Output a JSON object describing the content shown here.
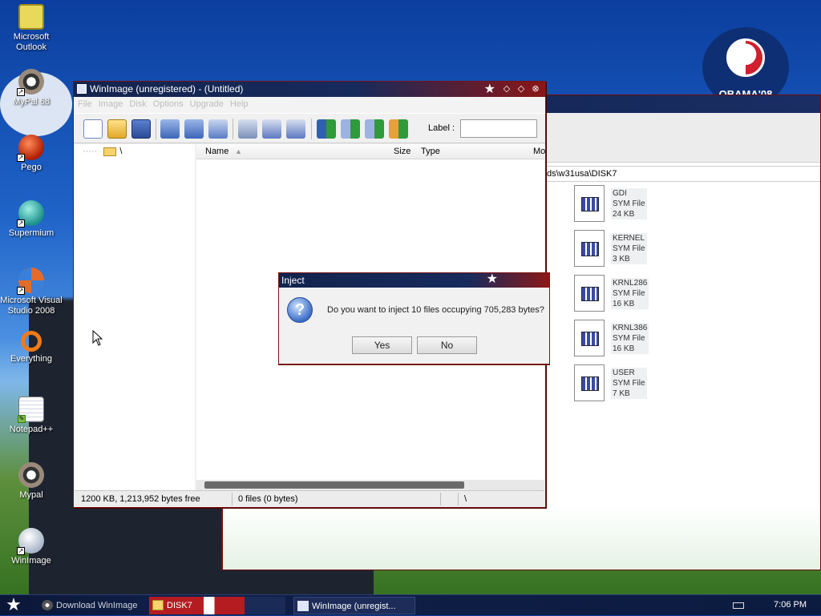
{
  "desktop": {
    "icons": [
      {
        "label": "Microsoft Outlook"
      },
      {
        "label": "MyPal 68"
      },
      {
        "label": "Pego"
      },
      {
        "label": "Supermium"
      },
      {
        "label": "Microsoft Visual Studio 2008"
      },
      {
        "label": "Everything"
      },
      {
        "label": "Notepad++"
      },
      {
        "label": "Mypal"
      },
      {
        "label": "WinImage"
      }
    ],
    "logo_text": "OBAMA'08"
  },
  "explorer": {
    "address": "ds\\w31usa\\DISK7",
    "files": [
      {
        "name": "GDI",
        "type": "SYM File",
        "size": "24 KB"
      },
      {
        "name": "KERNEL",
        "type": "SYM File",
        "size": "3 KB"
      },
      {
        "name": "KRNL286",
        "type": "SYM File",
        "size": "16 KB"
      },
      {
        "name": "KRNL386",
        "type": "SYM File",
        "size": "16 KB"
      },
      {
        "name": "USER",
        "type": "SYM File",
        "size": "7 KB"
      }
    ]
  },
  "winimage": {
    "title": "WinImage (unregistered) - (Untitled)",
    "menu": [
      "File",
      "Image",
      "Disk",
      "Options",
      "Upgrade",
      "Help"
    ],
    "label_caption": "Label :",
    "tree_root": "\\",
    "columns": {
      "name": "Name",
      "size": "Size",
      "type": "Type",
      "modified": "Mo"
    },
    "status": {
      "disk": "1200 KB, 1,213,952 bytes free",
      "files": "0 files (0 bytes)",
      "path": "\\"
    }
  },
  "dialog": {
    "title": "Inject",
    "message": "Do you want to inject 10 files occupying 705,283 bytes?",
    "yes": "Yes",
    "no": "No"
  },
  "taskbar": {
    "tasks": [
      "Download WinImage",
      "DISK7",
      "WinImage (unregist..."
    ],
    "clock": "7:06 PM"
  }
}
